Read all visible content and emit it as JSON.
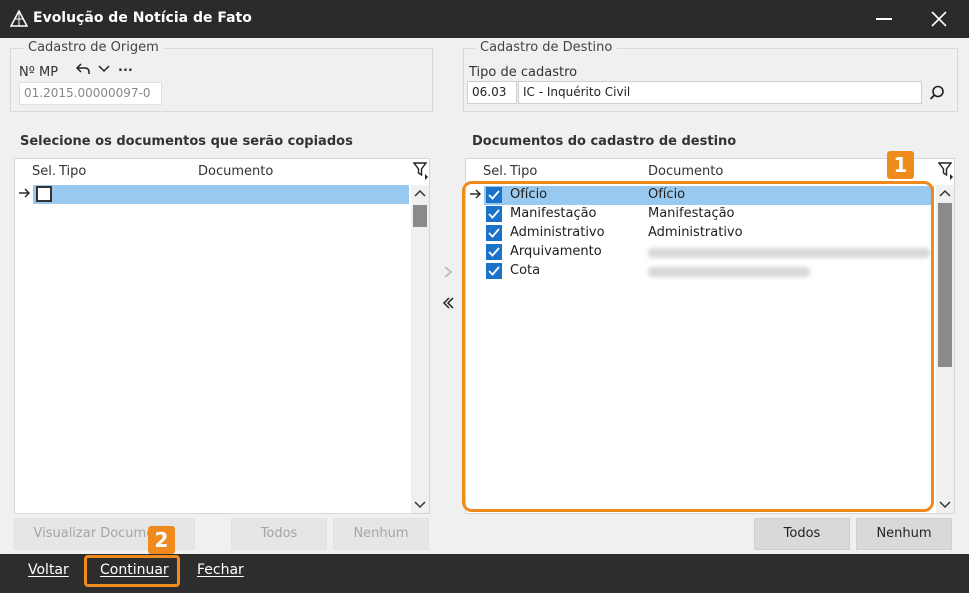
{
  "window": {
    "title": "Evolução de Notícia de Fato"
  },
  "origem": {
    "legend": "Cadastro de Origem",
    "mp_label": "Nº MP",
    "mp_value": "01.2015.00000097-0",
    "more_label": "..."
  },
  "destino": {
    "legend": "Cadastro de Destino",
    "tipo_label": "Tipo de cadastro",
    "tipo_code": "06.03",
    "tipo_desc": "IC - Inquérito Civil"
  },
  "left_panel": {
    "title": "Selecione os documentos que serão copiados",
    "columns": {
      "sel": "Sel.",
      "tipo": "Tipo",
      "documento": "Documento"
    },
    "buttons": {
      "visualizar": "Visualizar Documento",
      "todos": "Todos",
      "nenhum": "Nenhum"
    }
  },
  "right_panel": {
    "title": "Documentos do cadastro de destino",
    "columns": {
      "sel": "Sel.",
      "tipo": "Tipo",
      "documento": "Documento"
    },
    "rows": [
      {
        "tipo": "Ofício",
        "documento": "Ofício",
        "selected": true
      },
      {
        "tipo": "Manifestação",
        "documento": "Manifestação",
        "selected": false
      },
      {
        "tipo": "Administrativo",
        "documento": "Administrativo",
        "selected": false
      },
      {
        "tipo": "Arquivamento",
        "documento": "",
        "selected": false
      },
      {
        "tipo": "Cota",
        "documento": "",
        "selected": false
      }
    ],
    "buttons": {
      "todos": "Todos",
      "nenhum": "Nenhum"
    }
  },
  "footer": {
    "voltar": "Voltar",
    "continuar": "Continuar",
    "fechar": "Fechar"
  },
  "annotations": {
    "badge1": "1",
    "badge2": "2"
  },
  "colors": {
    "accent": "#ef8a1e",
    "selection": "#99c9ef",
    "checkbox": "#1a73c9",
    "titlebar": "#2b2b2b"
  }
}
